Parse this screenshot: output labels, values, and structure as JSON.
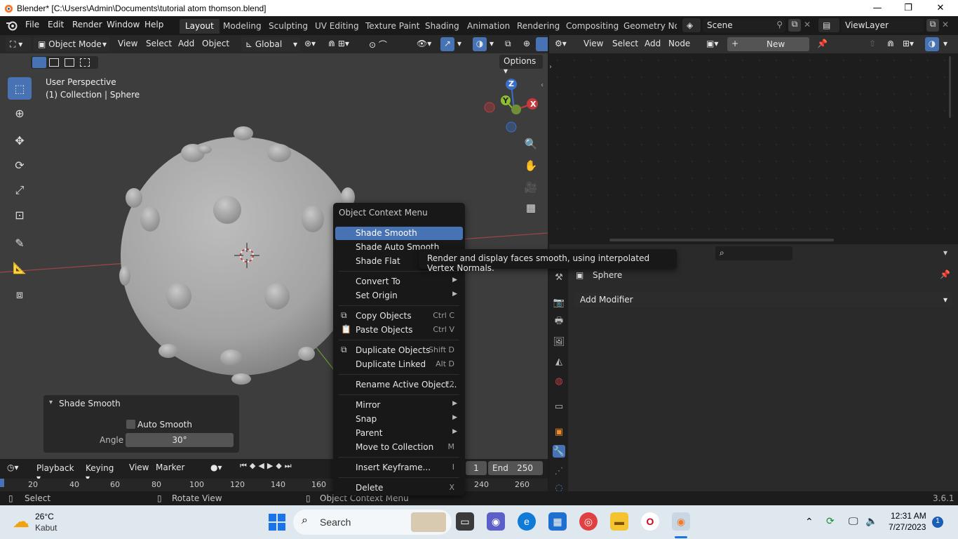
{
  "window": {
    "title": "Blender* [C:\\Users\\Admin\\Documents\\tutorial atom thomson.blend]",
    "controls": [
      "—",
      "❐",
      "✕"
    ]
  },
  "topbar": {
    "menus": [
      "File",
      "Edit",
      "Render",
      "Window",
      "Help"
    ],
    "workspaces": [
      "Layout",
      "Modeling",
      "Sculpting",
      "UV Editing",
      "Texture Paint",
      "Shading",
      "Animation",
      "Rendering",
      "Compositing",
      "Geometry Noc"
    ],
    "active_workspace": "Layout",
    "scene": "Scene",
    "view_layer": "ViewLayer"
  },
  "viewport": {
    "mode": "Object Mode",
    "menus": [
      "View",
      "Select",
      "Add",
      "Object"
    ],
    "transform_orientation": "Global",
    "options_label": "Options",
    "perspective_label": "User Perspective",
    "collection_label": "(1) Collection | Sphere",
    "gizmo": {
      "z": "Z",
      "y": "Y",
      "x": "X"
    }
  },
  "node_editor": {
    "menus": [
      "View",
      "Select",
      "Add",
      "Node"
    ],
    "new_label": "New"
  },
  "context_menu": {
    "title": "Object Context Menu",
    "items": [
      {
        "label": "Shade Smooth",
        "shortcut": "",
        "submenu": false,
        "highlighted": true
      },
      {
        "label": "Shade Auto Smooth",
        "shortcut": "",
        "submenu": false
      },
      {
        "label": "Shade Flat",
        "shortcut": "",
        "submenu": false
      },
      {
        "label": "Convert To",
        "shortcut": "",
        "submenu": true
      },
      {
        "label": "Set Origin",
        "shortcut": "",
        "submenu": true
      },
      {
        "label": "Copy Objects",
        "shortcut": "Ctrl C",
        "submenu": false
      },
      {
        "label": "Paste Objects",
        "shortcut": "Ctrl V",
        "submenu": false
      },
      {
        "label": "Duplicate Objects",
        "shortcut": "Shift D",
        "submenu": false
      },
      {
        "label": "Duplicate Linked",
        "shortcut": "Alt D",
        "submenu": false
      },
      {
        "label": "Rename Active Object...",
        "shortcut": "F2",
        "submenu": false
      },
      {
        "label": "Mirror",
        "shortcut": "",
        "submenu": true
      },
      {
        "label": "Snap",
        "shortcut": "",
        "submenu": true
      },
      {
        "label": "Parent",
        "shortcut": "",
        "submenu": true
      },
      {
        "label": "Move to Collection",
        "shortcut": "M",
        "submenu": false
      },
      {
        "label": "Insert Keyframe...",
        "shortcut": "I",
        "submenu": false
      },
      {
        "label": "Delete",
        "shortcut": "X",
        "submenu": false
      }
    ]
  },
  "tooltip": "Render and display faces smooth, using interpolated Vertex Normals.",
  "redo_panel": {
    "title": "Shade Smooth",
    "auto_smooth_label": "Auto Smooth",
    "auto_smooth_checked": false,
    "angle_label": "Angle",
    "angle_value": "30°"
  },
  "properties": {
    "object_name": "Sphere",
    "add_modifier_label": "Add Modifier"
  },
  "timeline": {
    "menus": [
      "Playback",
      "Keying",
      "View",
      "Marker"
    ],
    "start_value": "1",
    "end_label": "End",
    "end_value": "250",
    "ruler": [
      "20",
      "40",
      "60",
      "80",
      "100",
      "120",
      "140",
      "160",
      "240",
      "260"
    ]
  },
  "statusbar": {
    "select": "Select",
    "rotate": "Rotate View",
    "context": "Object Context Menu",
    "version": "3.6.1"
  },
  "taskbar": {
    "weather_temp": "26°C",
    "weather_desc": "Kabut",
    "search": "Search",
    "time": "12:31 AM",
    "date": "7/27/2023",
    "notification_count": "1"
  },
  "colors": {
    "accent": "#4772b3",
    "viewport_bg": "#3d3d3d",
    "panel_bg": "#2a2a2a",
    "axis_x": "#c83a3a",
    "axis_y": "#8fbf2f",
    "axis_z": "#3a6fc8"
  }
}
